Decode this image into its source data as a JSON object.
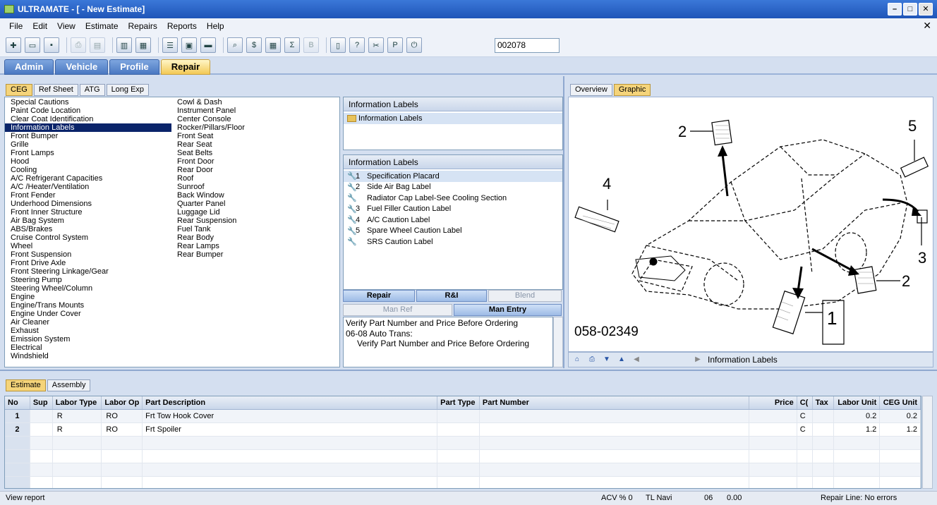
{
  "window": {
    "title": "ULTRAMATE - [ - New Estimate]"
  },
  "menu": [
    "File",
    "Edit",
    "View",
    "Estimate",
    "Repairs",
    "Reports",
    "Help"
  ],
  "toolbar": {
    "estimate_number": "002078"
  },
  "main_tabs": [
    "Admin",
    "Vehicle",
    "Profile",
    "Repair"
  ],
  "ceg_tabs": [
    "CEG",
    "Ref Sheet",
    "ATG",
    "Long Exp"
  ],
  "ceg_col1": [
    "Special Cautions",
    "Paint Code Location",
    "Clear Coat Identification",
    "Information Labels",
    "Front Bumper",
    "Grille",
    "Front Lamps",
    "Hood",
    "Cooling",
    "A/C Refrigerant Capacities",
    "A/C /Heater/Ventilation",
    "Front Fender",
    "Underhood Dimensions",
    "Front Inner Structure",
    "Air Bag System",
    "ABS/Brakes",
    "Cruise Control System",
    "Wheel",
    "Front Suspension",
    "Front Drive Axle",
    "Front Steering Linkage/Gear",
    "Steering Pump",
    "Steering Wheel/Column",
    "Engine",
    "Engine/Trans Mounts",
    "Engine Under Cover",
    "Air Cleaner",
    "Exhaust",
    "Emission System",
    "Electrical",
    "Windshield"
  ],
  "ceg_col2": [
    "Cowl & Dash",
    "Instrument Panel",
    "Center Console",
    "Rocker/Pillars/Floor",
    "Front Seat",
    "Rear Seat",
    "Seat Belts",
    "Front Door",
    "Rear Door",
    "Roof",
    "Sunroof",
    "Back Window",
    "Quarter Panel",
    "Luggage Lid",
    "Rear Suspension",
    "Fuel Tank",
    "Rear Body",
    "Rear Lamps",
    "Rear Bumper"
  ],
  "group_panel": {
    "header": "Information Labels",
    "folder": "Information Labels"
  },
  "labels_panel": {
    "header": "Information Labels",
    "items": [
      {
        "num": "1",
        "text": "Specification Placard"
      },
      {
        "num": "2",
        "text": "Side Air Bag Label"
      },
      {
        "num": "",
        "text": "Radiator Cap Label-See Cooling Section"
      },
      {
        "num": "3",
        "text": "Fuel Filler Caution Label"
      },
      {
        "num": "4",
        "text": "A/C Caution Label"
      },
      {
        "num": "5",
        "text": "Spare Wheel Caution Label"
      },
      {
        "num": "",
        "text": "SRS Caution Label"
      }
    ]
  },
  "op_buttons": {
    "repair": "Repair",
    "ri": "R&I",
    "blend": "Blend",
    "man_ref": "Man Ref",
    "man_entry": "Man Entry"
  },
  "note": {
    "line1": "Verify Part Number and Price Before Ordering",
    "line2": "06-08 Auto Trans:",
    "line3": "Verify Part Number and Price Before Ordering"
  },
  "graphic_tabs": [
    "Overview",
    "Graphic"
  ],
  "graphic": {
    "callouts": [
      "1",
      "2",
      "2",
      "3",
      "4",
      "5"
    ],
    "figure_id": "058-02349",
    "footer_label": "Information Labels"
  },
  "bottom_tabs": [
    "Estimate",
    "Assembly"
  ],
  "grid": {
    "columns": [
      "No",
      "Sup",
      "Labor Type",
      "Labor Op",
      "Part Description",
      "Part Type",
      "Part Number",
      "Price",
      "C(",
      "Tax",
      "Labor Unit",
      "CEG Unit"
    ],
    "rows": [
      {
        "no": "1",
        "sup": "",
        "labor_type": "R",
        "labor_op": "RO",
        "desc": "Frt Tow Hook Cover",
        "part_type": "",
        "part_number": "",
        "price": "",
        "c": "C",
        "tax": "",
        "labor_unit": "0.2",
        "ceg_unit": "0.2"
      },
      {
        "no": "2",
        "sup": "",
        "labor_type": "R",
        "labor_op": "RO",
        "desc": "Frt Spoiler",
        "part_type": "",
        "part_number": "",
        "price": "",
        "c": "C",
        "tax": "",
        "labor_unit": "1.2",
        "ceg_unit": "1.2"
      }
    ]
  },
  "status": {
    "left": "View report",
    "acv": "ACV % 0",
    "tl": "TL Navi",
    "num1": "06",
    "num2": "0.00",
    "right": "Repair Line: No errors"
  },
  "colors": {
    "title_bar": "#1f55b8",
    "active_tab": "#f3c955",
    "selection": "#0a246a"
  }
}
